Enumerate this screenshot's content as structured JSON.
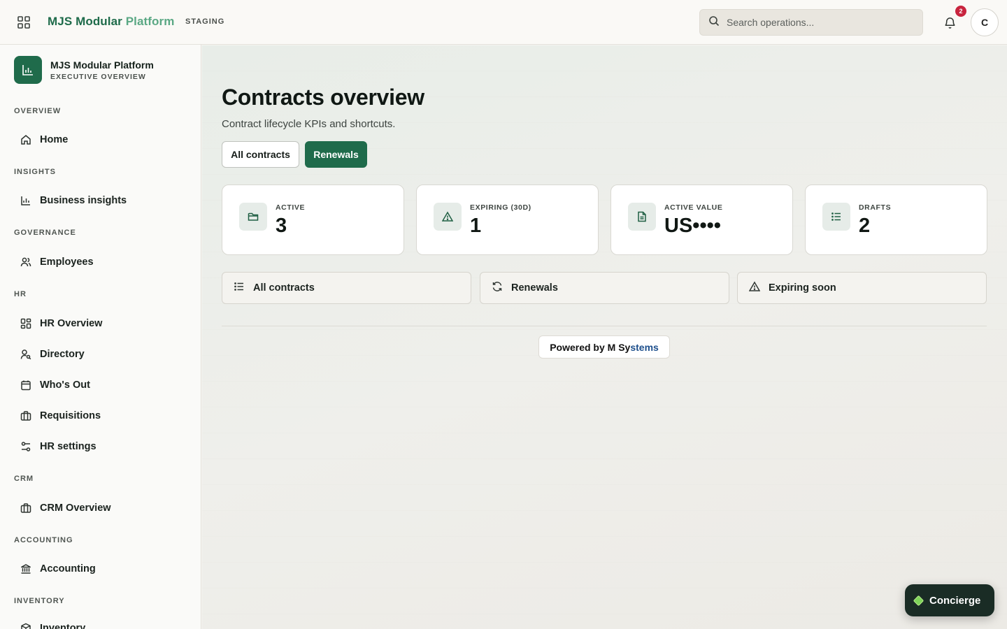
{
  "topbar": {
    "brand_main": "MJS Modular ",
    "brand_accent": "Platform",
    "env": "STAGING",
    "search_placeholder": "Search operations...",
    "notification_count": "2",
    "avatar_initial": "C"
  },
  "sidebar": {
    "title": "MJS Modular Platform",
    "subtitle": "EXECUTIVE OVERVIEW",
    "sections": {
      "overview": "OVERVIEW",
      "insights": "INSIGHTS",
      "governance": "GOVERNANCE",
      "hr": "HR",
      "crm": "CRM",
      "accounting": "ACCOUNTING",
      "inventory": "INVENTORY"
    },
    "items": {
      "home": "Home",
      "business_insights": "Business insights",
      "employees": "Employees",
      "hr_overview": "HR Overview",
      "directory": "Directory",
      "whos_out": "Who's Out",
      "requisitions": "Requisitions",
      "hr_settings": "HR settings",
      "crm_overview": "CRM Overview",
      "accounting": "Accounting",
      "inventory": "Inventory"
    }
  },
  "main": {
    "title": "Contracts overview",
    "subtitle": "Contract lifecycle KPIs and shortcuts.",
    "tabs": {
      "all": "All contracts",
      "renewals": "Renewals"
    },
    "kpis": {
      "active": {
        "label": "ACTIVE",
        "value": "3",
        "icon": "folder-icon"
      },
      "expiring": {
        "label": "EXPIRING (30D)",
        "value": "1",
        "icon": "warning-icon"
      },
      "active_value": {
        "label": "ACTIVE VALUE",
        "value": "US••••",
        "icon": "document-icon"
      },
      "drafts": {
        "label": "DRAFTS",
        "value": "2",
        "icon": "list-icon"
      }
    },
    "shortcuts": {
      "all": "All contracts",
      "renewals": "Renewals",
      "expiring": "Expiring soon"
    },
    "powered_prefix": "Powered by M Sy",
    "powered_accent": "stems"
  },
  "concierge": {
    "label": "Concierge"
  },
  "colors": {
    "brand": "#1f6b4b",
    "badge": "#c8243e",
    "accent_light": "#5aa884"
  }
}
